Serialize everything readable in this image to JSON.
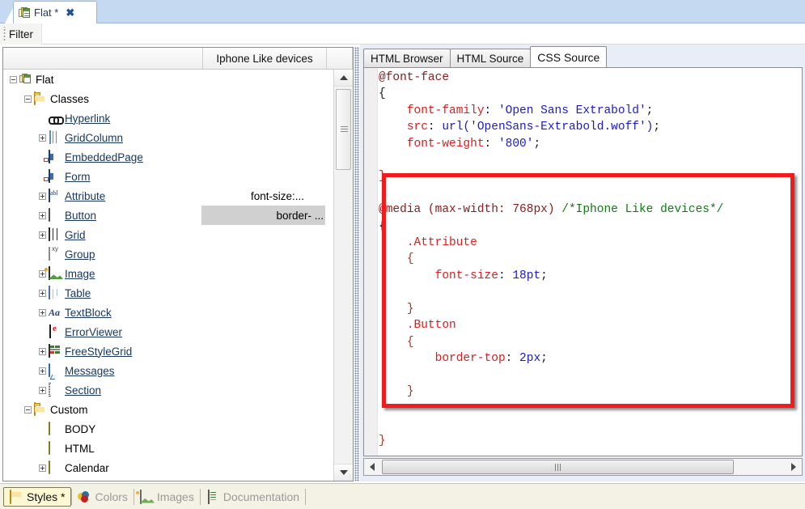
{
  "window": {
    "doc_tab": {
      "title": "Flat *",
      "close_label": "✖",
      "icon": "document-stack-icon"
    },
    "filter": {
      "label": "Filter"
    }
  },
  "tree_panel": {
    "columns": [
      {
        "label": ""
      },
      {
        "label": "Iphone Like devices"
      }
    ],
    "rows": [
      {
        "label": "Flat",
        "indent": 0,
        "expander": "minus",
        "icon": "document-stack-icon",
        "link": false,
        "media": ""
      },
      {
        "label": "Classes",
        "indent": 1,
        "expander": "minus",
        "icon": "folder-icon",
        "link": false,
        "media": ""
      },
      {
        "label": "Hyperlink",
        "indent": 2,
        "expander": "none",
        "icon": "chain-link-icon",
        "link": true,
        "media": ""
      },
      {
        "label": "GridColumn",
        "indent": 2,
        "expander": "plus",
        "icon": "grid-column-icon",
        "link": true,
        "media": ""
      },
      {
        "label": "EmbeddedPage",
        "indent": 2,
        "expander": "none",
        "icon": "page-icon",
        "link": true,
        "media": ""
      },
      {
        "label": "Form",
        "indent": 2,
        "expander": "none",
        "icon": "page-icon",
        "link": true,
        "media": ""
      },
      {
        "label": "Attribute",
        "indent": 2,
        "expander": "plus",
        "icon": "abl-textbox-icon",
        "link": true,
        "media": "font-size:...",
        "media_selected": false
      },
      {
        "label": "Button",
        "indent": 2,
        "expander": "plus",
        "icon": "button-icon",
        "link": true,
        "media": "border- ...",
        "media_selected": true
      },
      {
        "label": "Grid",
        "indent": 2,
        "expander": "plus",
        "icon": "grid-icon",
        "link": true,
        "media": ""
      },
      {
        "label": "Group",
        "indent": 2,
        "expander": "none",
        "icon": "group-icon",
        "link": true,
        "media": ""
      },
      {
        "label": "Image",
        "indent": 2,
        "expander": "plus",
        "icon": "image-icon",
        "link": true,
        "media": ""
      },
      {
        "label": "Table",
        "indent": 2,
        "expander": "plus",
        "icon": "table-icon",
        "link": true,
        "media": ""
      },
      {
        "label": "TextBlock",
        "indent": 2,
        "expander": "plus",
        "icon": "textblock-icon",
        "link": true,
        "media": ""
      },
      {
        "label": "ErrorViewer",
        "indent": 2,
        "expander": "none",
        "icon": "error-viewer-icon",
        "link": true,
        "media": ""
      },
      {
        "label": "FreeStyleGrid",
        "indent": 2,
        "expander": "plus",
        "icon": "freestyle-grid-icon",
        "link": true,
        "media": ""
      },
      {
        "label": "Messages",
        "indent": 2,
        "expander": "plus",
        "icon": "messages-icon",
        "link": true,
        "media": ""
      },
      {
        "label": "Section",
        "indent": 2,
        "expander": "plus",
        "icon": "section-icon",
        "link": true,
        "media": ""
      },
      {
        "label": "Custom",
        "indent": 1,
        "expander": "minus",
        "icon": "folder-icon",
        "link": false,
        "media": ""
      },
      {
        "label": "BODY",
        "indent": 2,
        "expander": "none",
        "icon": "oval-tag-icon",
        "link": false,
        "media": ""
      },
      {
        "label": "HTML",
        "indent": 2,
        "expander": "none",
        "icon": "oval-tag-icon",
        "link": false,
        "media": ""
      },
      {
        "label": "Calendar",
        "indent": 2,
        "expander": "plus",
        "icon": "oval-tag-icon",
        "link": false,
        "media": ""
      }
    ],
    "scrollbar": {
      "up_arrow": "scroll-up-icon",
      "down_arrow": "scroll-down-icon"
    }
  },
  "editor_panel": {
    "tabs": [
      {
        "label": "HTML Browser",
        "active": false
      },
      {
        "label": "HTML Source",
        "active": false
      },
      {
        "label": "CSS Source",
        "active": true
      }
    ],
    "code_lines": [
      [
        {
          "t": "@font-face",
          "c": "atrule"
        }
      ],
      [
        {
          "t": "{",
          "c": "plain"
        }
      ],
      [
        {
          "t": "    ",
          "c": "plain"
        },
        {
          "t": "font-family",
          "c": "prop"
        },
        {
          "t": ": ",
          "c": "plain"
        },
        {
          "t": "'Open Sans Extrabold'",
          "c": "val"
        },
        {
          "t": ";",
          "c": "plain"
        }
      ],
      [
        {
          "t": "    ",
          "c": "plain"
        },
        {
          "t": "src",
          "c": "prop"
        },
        {
          "t": ": ",
          "c": "plain"
        },
        {
          "t": "url('OpenSans-Extrabold.woff')",
          "c": "val"
        },
        {
          "t": ";",
          "c": "plain"
        }
      ],
      [
        {
          "t": "    ",
          "c": "plain"
        },
        {
          "t": "font-weight",
          "c": "prop"
        },
        {
          "t": ": ",
          "c": "plain"
        },
        {
          "t": "'800'",
          "c": "val"
        },
        {
          "t": ";",
          "c": "plain"
        }
      ],
      [
        {
          "t": "",
          "c": "plain"
        }
      ],
      [
        {
          "t": "}",
          "c": "brace"
        }
      ],
      [
        {
          "t": "",
          "c": "plain"
        }
      ],
      [
        {
          "t": "@media ",
          "c": "atrule"
        },
        {
          "t": "(max-width: 768px) ",
          "c": "atrule"
        },
        {
          "t": "/*Iphone Like devices*/",
          "c": "cmt"
        }
      ],
      [
        {
          "t": "{",
          "c": "plain"
        }
      ],
      [
        {
          "t": "    ",
          "c": "plain"
        },
        {
          "t": ".Attribute",
          "c": "sel"
        }
      ],
      [
        {
          "t": "    ",
          "c": "plain"
        },
        {
          "t": "{",
          "c": "brace"
        }
      ],
      [
        {
          "t": "        ",
          "c": "plain"
        },
        {
          "t": "font-size",
          "c": "prop"
        },
        {
          "t": ": ",
          "c": "plain"
        },
        {
          "t": "18pt",
          "c": "val"
        },
        {
          "t": ";",
          "c": "plain"
        }
      ],
      [
        {
          "t": "",
          "c": "plain"
        }
      ],
      [
        {
          "t": "    ",
          "c": "plain"
        },
        {
          "t": "}",
          "c": "brace"
        }
      ],
      [
        {
          "t": "    ",
          "c": "plain"
        },
        {
          "t": ".Button",
          "c": "sel"
        }
      ],
      [
        {
          "t": "    ",
          "c": "plain"
        },
        {
          "t": "{",
          "c": "brace"
        }
      ],
      [
        {
          "t": "        ",
          "c": "plain"
        },
        {
          "t": "border-top",
          "c": "prop"
        },
        {
          "t": ": ",
          "c": "plain"
        },
        {
          "t": "2px",
          "c": "val"
        },
        {
          "t": ";",
          "c": "plain"
        }
      ],
      [
        {
          "t": "",
          "c": "plain"
        }
      ],
      [
        {
          "t": "    ",
          "c": "plain"
        },
        {
          "t": "}",
          "c": "brace"
        }
      ],
      [
        {
          "t": "",
          "c": "plain"
        }
      ],
      [
        {
          "t": "",
          "c": "plain"
        }
      ],
      [
        {
          "t": "}",
          "c": "brace"
        }
      ]
    ],
    "annotation": {
      "kind": "red-rectangle-highlight",
      "color": "#f21a1a"
    },
    "hscroll": {
      "left_arrow": "scroll-left-icon",
      "right_arrow": "scroll-right-icon"
    }
  },
  "bottom_tabs": [
    {
      "label": "Styles *",
      "icon": "folder-icon",
      "active": true
    },
    {
      "label": "Colors",
      "icon": "colors-icon",
      "active": false
    },
    {
      "label": "Images",
      "icon": "image-icon",
      "active": false
    },
    {
      "label": "Documentation",
      "icon": "documentation-icon",
      "active": false
    }
  ],
  "colors": {
    "accent_tab_strip": "#c5d9f1",
    "link_text": "#17365d",
    "annotation_red": "#f21a1a",
    "selection_gray": "#d0d0d0",
    "status_bar": "#f4f2e4"
  }
}
